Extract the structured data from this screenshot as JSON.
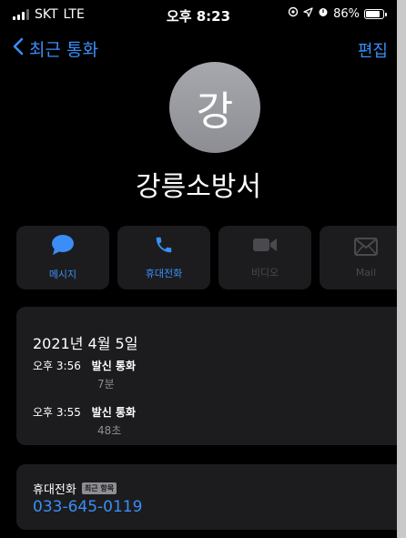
{
  "status_bar": {
    "carrier": "SKT",
    "network": "LTE",
    "time": "오후 8:23",
    "battery_percent": "86%"
  },
  "nav": {
    "back_label": "최근 통화",
    "edit_label": "편집"
  },
  "contact": {
    "avatar_initial": "강",
    "name": "강릉소방서"
  },
  "actions": [
    {
      "label": "메시지",
      "icon": "message-icon",
      "enabled": true
    },
    {
      "label": "휴대전화",
      "icon": "phone-icon",
      "enabled": true
    },
    {
      "label": "비디오",
      "icon": "video-icon",
      "enabled": false
    },
    {
      "label": "Mail",
      "icon": "mail-icon",
      "enabled": false
    }
  ],
  "history": {
    "date": "2021년 4월 5일",
    "entries": [
      {
        "time": "오후 3:56",
        "type": "발신 통화",
        "duration": "7분"
      },
      {
        "time": "오후 3:55",
        "type": "발신 통화",
        "duration": "48초"
      }
    ]
  },
  "phone_entry": {
    "label": "휴대전화",
    "badge": "최근 항목",
    "number": "033-645-0119"
  },
  "colors": {
    "accent": "#3a8ef6",
    "card": "#1c1c1e",
    "background": "#000000"
  }
}
